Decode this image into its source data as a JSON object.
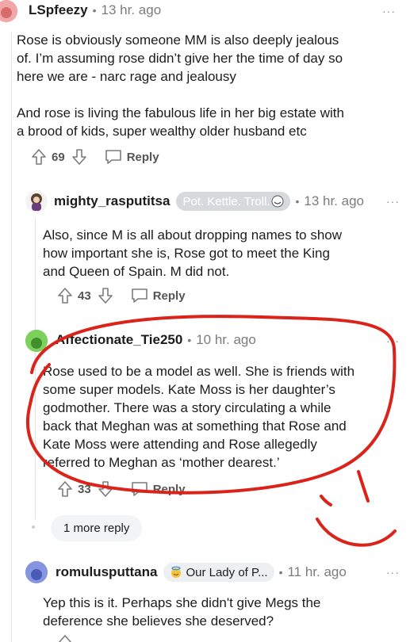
{
  "comments": [
    {
      "username": "LSpfeezy",
      "time": "13 hr. ago",
      "body_lines": [
        "Rose is obviously someone MM is also deeply jealous",
        "of. I’m assuming rose didn’t give her the time of day so",
        "here we are - narc rage and jealousy",
        "",
        "And rose is living the fabulous life in her big estate with",
        "a brood of kids, super wealthy older husband etc"
      ],
      "votes": "69",
      "reply_label": "Reply"
    },
    {
      "username": "mighty_rasputitsa",
      "flair": "Pot. Kettle. Troll.",
      "time": "13 hr. ago",
      "body_lines": [
        "Also, since M is all about dropping names to show",
        "how important she is, Rose got to meet the King",
        "and Queen of Spain. M did not."
      ],
      "votes": "43",
      "reply_label": "Reply"
    },
    {
      "username": "Affectionate_Tie250",
      "time": "10 hr. ago",
      "body_lines": [
        "Rose used to be a model as well. She is friends with",
        "some super models. Kate Moss is her daughter’s",
        "godmother. There was a story circulating a while",
        "back that Meghan was at something that Rose and",
        "Kate Moss were attending and Rose allegedly",
        "referred to Meghan as ‘mother dearest.’"
      ],
      "votes": "33",
      "reply_label": "Reply"
    },
    {
      "username": "romulusputtana",
      "flair": "Our Lady of P...",
      "time": "11 hr. ago",
      "body_lines": [
        "Yep this is it. Perhaps she didn't give Megs the",
        "deference she believes she deserved?"
      ]
    }
  ],
  "more_replies_label": "1 more reply",
  "more_icon": "···",
  "icons": {
    "upvote": "up-arrow-icon",
    "downvote": "down-arrow-icon",
    "reply": "speech-bubble-icon",
    "more": "ellipsis-icon"
  },
  "colors": {
    "annotation": "#d9231b",
    "avatar1": "#e88a8a",
    "avatar3": "#6ac24c",
    "avatar4": "#6b7fd7"
  }
}
